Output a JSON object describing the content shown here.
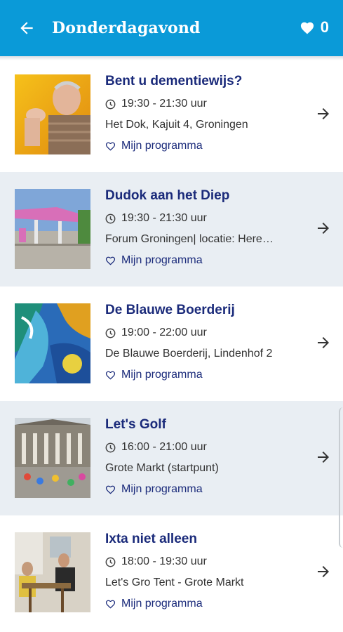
{
  "header": {
    "title": "Donderdagavond",
    "back_icon": "arrow-left-icon",
    "favorites_icon": "heart-icon",
    "favorites_count": "0"
  },
  "colors": {
    "appbar": "#0a9ad8",
    "title_text": "#1a2a7a",
    "alt_row": "#e9eef3"
  },
  "events": [
    {
      "title": "Bent u dementiewijs?",
      "time": "19:30 - 21:30 uur",
      "location": "Het Dok, Kajuit 4, Groningen",
      "program_label": "Mijn programma"
    },
    {
      "title": "Dudok aan het Diep",
      "time": "19:30 - 21:30 uur",
      "location": "Forum Groningen| locatie: Here…",
      "program_label": "Mijn programma"
    },
    {
      "title": "De Blauwe Boerderij",
      "time": "19:00 - 22:00 uur",
      "location": "De Blauwe Boerderij, Lindenhof 2",
      "program_label": "Mijn programma"
    },
    {
      "title": "Let's Golf",
      "time": "16:00 - 21:00 uur",
      "location": "Grote Markt (startpunt)",
      "program_label": "Mijn programma"
    },
    {
      "title": "Ixta niet alleen",
      "time": "18:00 - 19:30 uur",
      "location": "Let's Gro Tent - Grote Markt",
      "program_label": "Mijn programma"
    }
  ]
}
